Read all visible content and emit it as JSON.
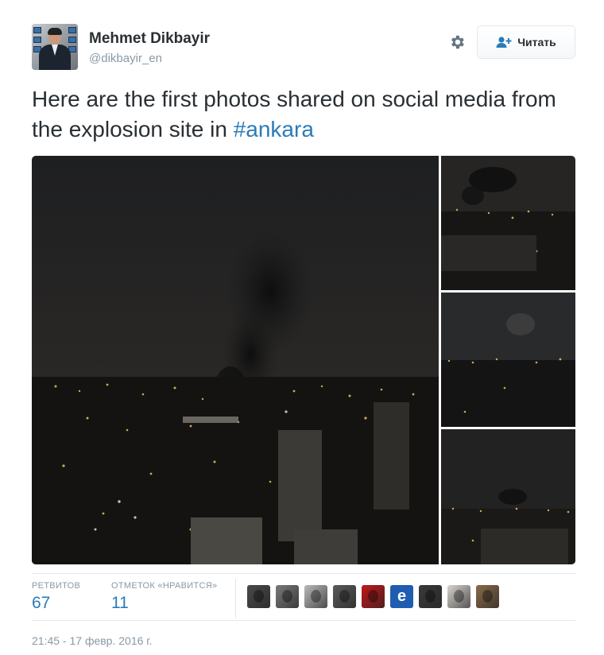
{
  "author": {
    "name": "Mehmet Dikbayir",
    "handle": "@dikbayir_en"
  },
  "actions": {
    "follow_label": "Читать",
    "settings_icon": "gear-icon",
    "follow_icon": "add-user-icon"
  },
  "tweet": {
    "text": "Here are the first photos shared on social media from the explosion site in ",
    "hashtag": "#ankara"
  },
  "media": {
    "photos": [
      {
        "description": "night city skyline with smoke plume"
      },
      {
        "description": "smoke over lit city"
      },
      {
        "description": "city lights with faint smoke"
      },
      {
        "description": "distant smoke over city"
      }
    ]
  },
  "stats": {
    "retweets_label": "РЕТВИТОВ",
    "retweets_count": "67",
    "likes_label": "ОТМЕТОК «НРАВИТСЯ»",
    "likes_count": "11"
  },
  "likers": [
    {
      "color": "#4a4a4a"
    },
    {
      "color": "#7a7a7a"
    },
    {
      "color": "#b9b9b9"
    },
    {
      "color": "#5b5b5b"
    },
    {
      "color": "#c0181a"
    },
    {
      "color": "#1f5db0",
      "glyph": "e"
    },
    {
      "color": "#3a3a3a"
    },
    {
      "color": "#d8d4cf"
    },
    {
      "color": "#8a6a4a"
    }
  ],
  "timestamp": "21:45 - 17 февр. 2016 г.",
  "colors": {
    "link": "#2b7bb9",
    "muted": "#8899a6",
    "text": "#292f33"
  }
}
